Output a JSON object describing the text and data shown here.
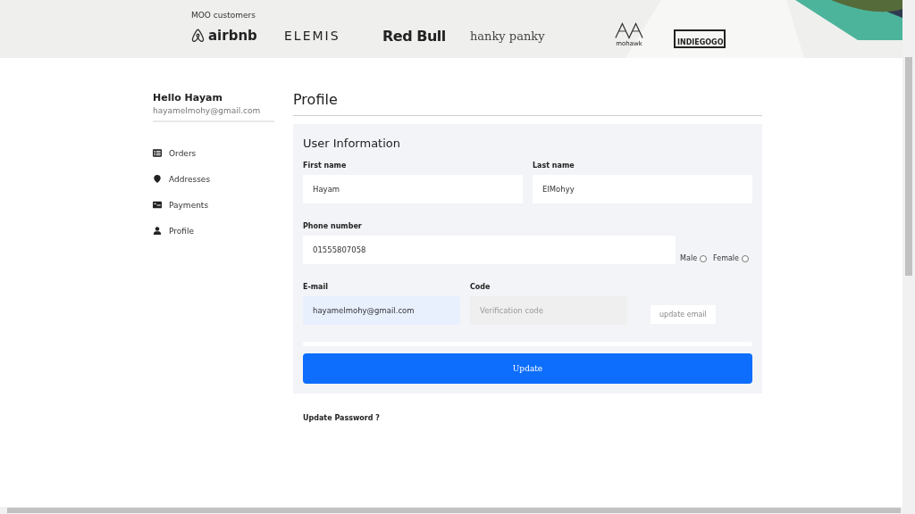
{
  "banner": {
    "caption": "MOO customers",
    "logos": [
      {
        "text": "airbnb",
        "kind": "airbnb"
      },
      {
        "text": "ELEMIS",
        "kind": "spaced"
      },
      {
        "text": "Red Bull",
        "kind": "bold"
      },
      {
        "text": "hanky panky",
        "kind": "script"
      },
      {
        "text": "mohawk",
        "kind": "mohawk"
      },
      {
        "text": "INDIEGOGO",
        "kind": "boxed"
      }
    ]
  },
  "sidebar": {
    "greeting": "Hello Hayam",
    "email": "hayamelmohy@gmail.com",
    "items": [
      {
        "label": "Orders",
        "kind": "list"
      },
      {
        "label": "Addresses",
        "kind": "pin"
      },
      {
        "label": "Payments",
        "kind": "card"
      },
      {
        "label": "Profile",
        "kind": "person"
      }
    ]
  },
  "profile": {
    "title": "Profile",
    "section_title": "User Information",
    "first_name": {
      "label": "First name",
      "value": "Hayam"
    },
    "last_name": {
      "label": "Last name",
      "value": "ElMohyy"
    },
    "phone": {
      "label": "Phone number",
      "value": "01555807058"
    },
    "gender": [
      {
        "label": "Male",
        "selected": false
      },
      {
        "label": "Female",
        "selected": false
      }
    ],
    "email": {
      "label": "E-mail",
      "value": "hayamelmohy@gmail.com"
    },
    "code": {
      "label": "Code",
      "placeholder": "Verification code"
    },
    "update_email_button": "update email",
    "update_button": "Update",
    "password_link": "Update Password ?"
  }
}
